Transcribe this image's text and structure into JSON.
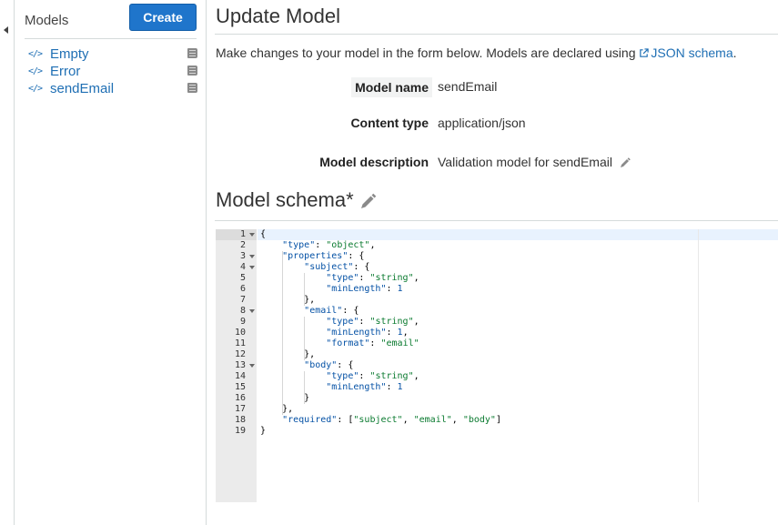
{
  "sidebar": {
    "title": "Models",
    "create_label": "Create",
    "items": [
      {
        "label": "Empty"
      },
      {
        "label": "Error"
      },
      {
        "label": "sendEmail"
      }
    ]
  },
  "main": {
    "title": "Update Model",
    "intro": "Make changes to your model in the form below. Models are declared using ",
    "intro_link": "JSON schema",
    "intro_end": ".",
    "fields": [
      {
        "label": "Model name",
        "value": "sendEmail"
      },
      {
        "label": "Content type",
        "value": "application/json"
      },
      {
        "label": "Model description",
        "value": "Validation model for sendEmail"
      }
    ],
    "schema_title": "Model schema*"
  },
  "editor": {
    "lines": [
      {
        "num": "1",
        "fold": true,
        "text": "{"
      },
      {
        "num": "2",
        "fold": false,
        "text": "    \"type\": \"object\","
      },
      {
        "num": "3",
        "fold": true,
        "text": "    \"properties\": {"
      },
      {
        "num": "4",
        "fold": true,
        "text": "        \"subject\": {"
      },
      {
        "num": "5",
        "fold": false,
        "text": "            \"type\": \"string\","
      },
      {
        "num": "6",
        "fold": false,
        "text": "            \"minLength\": 1"
      },
      {
        "num": "7",
        "fold": false,
        "text": "        },"
      },
      {
        "num": "8",
        "fold": true,
        "text": "        \"email\": {"
      },
      {
        "num": "9",
        "fold": false,
        "text": "            \"type\": \"string\","
      },
      {
        "num": "10",
        "fold": false,
        "text": "            \"minLength\": 1,"
      },
      {
        "num": "11",
        "fold": false,
        "text": "            \"format\": \"email\""
      },
      {
        "num": "12",
        "fold": false,
        "text": "        },"
      },
      {
        "num": "13",
        "fold": true,
        "text": "        \"body\": {"
      },
      {
        "num": "14",
        "fold": false,
        "text": "            \"type\": \"string\","
      },
      {
        "num": "15",
        "fold": false,
        "text": "            \"minLength\": 1"
      },
      {
        "num": "16",
        "fold": false,
        "text": "        }"
      },
      {
        "num": "17",
        "fold": false,
        "text": "    },"
      },
      {
        "num": "18",
        "fold": false,
        "text": "    \"required\": [\"subject\", \"email\", \"body\"]"
      },
      {
        "num": "19",
        "fold": false,
        "text": "}"
      }
    ]
  },
  "colors": {
    "accent": "#1f75cb",
    "link": "#1f6fb4",
    "string": "#0a7a2f",
    "key": "#0451a5"
  }
}
